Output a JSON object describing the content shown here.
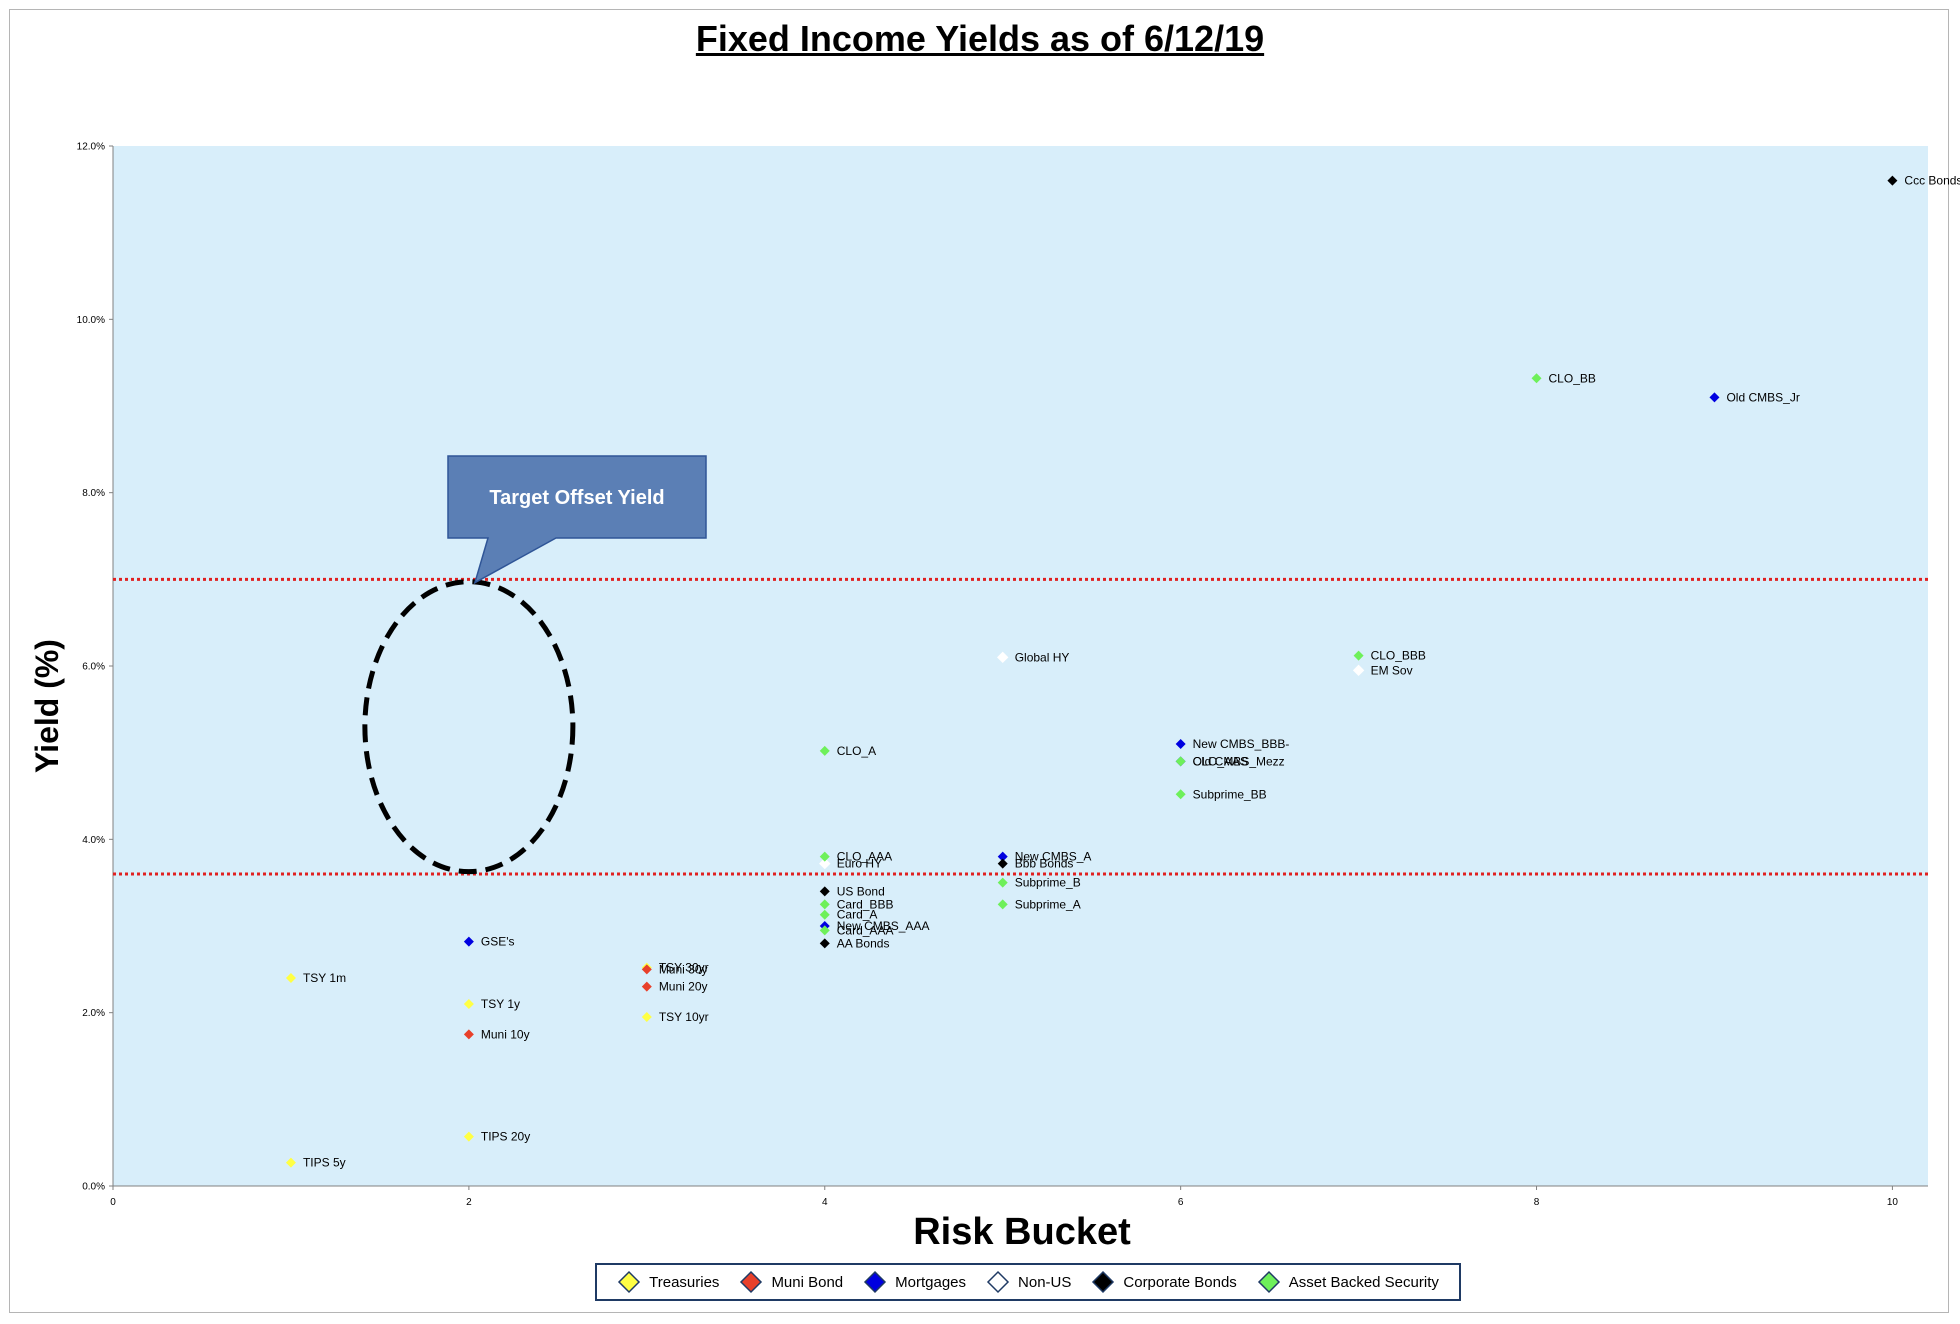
{
  "title": "Fixed Income Yields as of 6/12/19",
  "chart_data": {
    "type": "scatter",
    "title": "Fixed Income Yields as of 6/12/19",
    "xlabel": "Risk Bucket",
    "ylabel": "Yield (%)",
    "xlim": [
      0,
      10.2
    ],
    "ylim": [
      0,
      12
    ],
    "x_ticks": [
      "0",
      "2",
      "4",
      "6",
      "8",
      "10"
    ],
    "y_ticks": [
      "0.0%",
      "2.0%",
      "4.0%",
      "6.0%",
      "8.0%",
      "10.0%",
      "12.0%"
    ],
    "plot_background": "#d8eefa",
    "grid": false,
    "legend_position": "bottom",
    "reference_lines": [
      {
        "y": 7.0,
        "color": "#e02020",
        "style": "dotted"
      },
      {
        "y": 3.6,
        "color": "#e02020",
        "style": "dotted"
      }
    ],
    "annotation": {
      "text": "Target Offset Yield",
      "target": {
        "x": 2.0,
        "y": 5.3
      },
      "callout_color": "#5b7fb5"
    },
    "series": [
      {
        "name": "Treasuries",
        "color": "#ffff44",
        "points": [
          {
            "label": "TSY 1m",
            "x": 1,
            "y": 2.4
          },
          {
            "label": "TSY 1y",
            "x": 2,
            "y": 2.1
          },
          {
            "label": "TSY 10yr",
            "x": 3,
            "y": 1.95
          },
          {
            "label": "TSY 30yr",
            "x": 3,
            "y": 2.52
          },
          {
            "label": "TIPS 5y",
            "x": 1,
            "y": 0.27
          },
          {
            "label": "TIPS 20y",
            "x": 2,
            "y": 0.57
          }
        ]
      },
      {
        "name": "Muni Bond",
        "color": "#e8402a",
        "points": [
          {
            "label": "Muni 10y",
            "x": 2,
            "y": 1.75
          },
          {
            "label": "Muni 20y",
            "x": 3,
            "y": 2.3
          },
          {
            "label": "Muni 30y",
            "x": 3,
            "y": 2.5
          }
        ]
      },
      {
        "name": "Mortgages",
        "color": "#0000e0",
        "points": [
          {
            "label": "GSE's",
            "x": 2,
            "y": 2.82
          },
          {
            "label": "New CMBS_AAA",
            "x": 4,
            "y": 3.0
          },
          {
            "label": "New CMBS_A",
            "x": 5,
            "y": 3.8
          },
          {
            "label": "New CMBS_BBB-",
            "x": 6,
            "y": 5.1
          },
          {
            "label": "Old CMBS_Mezz",
            "x": 6,
            "y": 4.9
          },
          {
            "label": "Old CMBS_Jr",
            "x": 9,
            "y": 9.1
          }
        ]
      },
      {
        "name": "Non-US",
        "color": "#ffffff",
        "points": [
          {
            "label": "Euro HY",
            "x": 4,
            "y": 3.72
          },
          {
            "label": "Global HY",
            "x": 5,
            "y": 6.1
          },
          {
            "label": "EM Sov",
            "x": 7,
            "y": 5.95
          }
        ]
      },
      {
        "name": "Corporate Bonds",
        "color": "#000000",
        "points": [
          {
            "label": "US Bond",
            "x": 4,
            "y": 3.4
          },
          {
            "label": "AA Bonds",
            "x": 4,
            "y": 2.8
          },
          {
            "label": "Bbb Bonds",
            "x": 5,
            "y": 3.72
          },
          {
            "label": "Ccc Bonds",
            "x": 10,
            "y": 11.6
          }
        ]
      },
      {
        "name": "Asset Backed Security",
        "color": "#6ef05a",
        "points": [
          {
            "label": "CLO_AAA",
            "x": 4,
            "y": 3.8
          },
          {
            "label": "CLO_A",
            "x": 4,
            "y": 5.02
          },
          {
            "label": "Card_BBB",
            "x": 4,
            "y": 3.25
          },
          {
            "label": "Card_A",
            "x": 4,
            "y": 3.13
          },
          {
            "label": "Card_AAA",
            "x": 4,
            "y": 2.95
          },
          {
            "label": "Subprime_B",
            "x": 5,
            "y": 3.5
          },
          {
            "label": "Subprime_A",
            "x": 5,
            "y": 3.25
          },
          {
            "label": "CLO_AAS",
            "x": 6,
            "y": 4.9
          },
          {
            "label": "Subprime_BB",
            "x": 6,
            "y": 4.52
          },
          {
            "label": "CLO_BBB",
            "x": 7,
            "y": 6.12
          },
          {
            "label": "CLO_BB",
            "x": 8,
            "y": 9.32
          }
        ]
      }
    ]
  }
}
